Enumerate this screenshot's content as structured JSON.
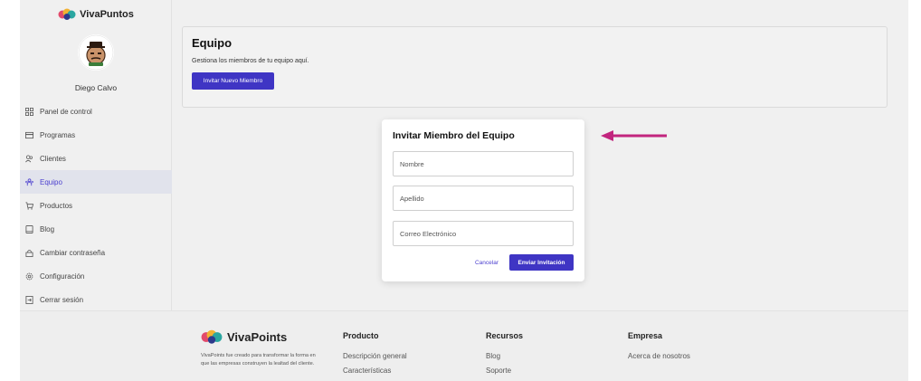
{
  "sidebar": {
    "brand": "VivaPuntos",
    "user_name": "Diego Calvo",
    "items": [
      {
        "label": "Panel de control",
        "icon": "dashboard-icon",
        "active": false
      },
      {
        "label": "Programas",
        "icon": "card-icon",
        "active": false
      },
      {
        "label": "Clientes",
        "icon": "users-icon",
        "active": false
      },
      {
        "label": "Equipo",
        "icon": "team-icon",
        "active": true
      },
      {
        "label": "Productos",
        "icon": "cart-icon",
        "active": false
      },
      {
        "label": "Blog",
        "icon": "book-icon",
        "active": false
      },
      {
        "label": "Cambiar contraseña",
        "icon": "lock-icon",
        "active": false
      },
      {
        "label": "Configuración",
        "icon": "gear-icon",
        "active": false
      },
      {
        "label": "Cerrar sesión",
        "icon": "logout-icon",
        "active": false
      }
    ]
  },
  "team": {
    "title": "Equipo",
    "description": "Gestiona los miembros de tu equipo aquí.",
    "invite_label": "Invitar Nuevo Miembro"
  },
  "modal": {
    "title": "Invitar Miembro del Equipo",
    "first_name_placeholder": "Nombre",
    "last_name_placeholder": "Apellido",
    "email_placeholder": "Correo Electrónico",
    "cancel_label": "Cancelar",
    "send_label": "Enviar Invitación"
  },
  "footer": {
    "brand": "VivaPoints",
    "description": "VivaPoints fue creado para transformar la forma en que las empresas construyen la lealtad del cliente.",
    "columns": [
      {
        "title": "Producto",
        "links": [
          "Descripción general",
          "Características"
        ]
      },
      {
        "title": "Recursos",
        "links": [
          "Blog",
          "Soporte"
        ]
      },
      {
        "title": "Empresa",
        "links": [
          "Acerca de nosotros"
        ]
      }
    ]
  },
  "colors": {
    "accent": "#3f35c4",
    "active_bg": "#e1e3ec",
    "annotation_arrow": "#c2257e"
  }
}
